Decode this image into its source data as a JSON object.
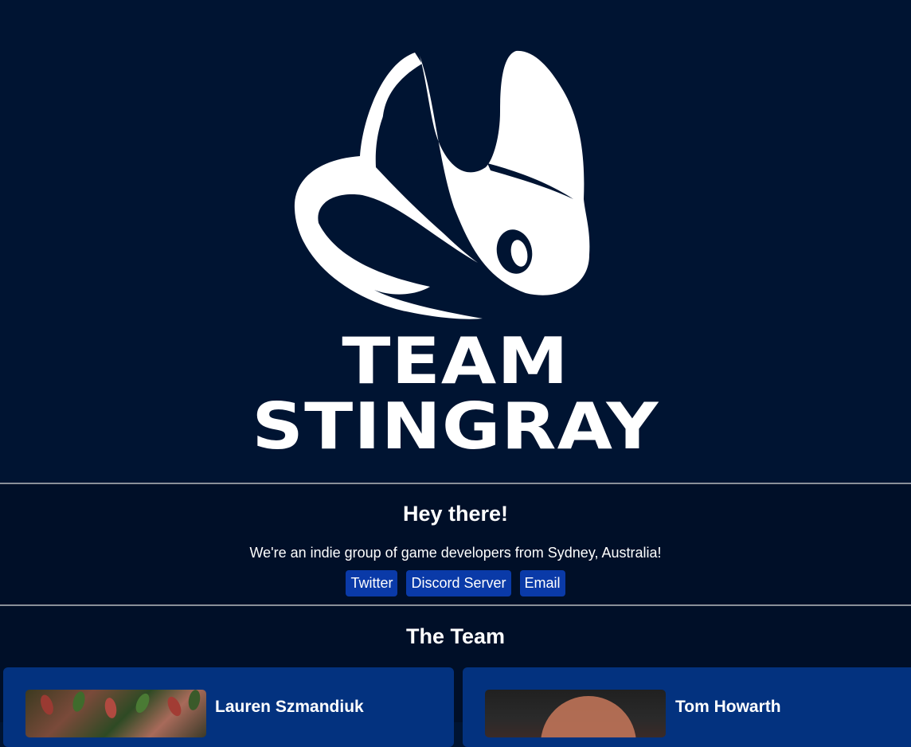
{
  "brand": {
    "logo_icon": "stingray-icon",
    "logo_line1": "TEAM",
    "logo_line2": "STINGRAY"
  },
  "intro": {
    "heading": "Hey there!",
    "description": "We're an indie group of game developers from Sydney, Australia!",
    "links": [
      {
        "label": "Twitter"
      },
      {
        "label": "Discord Server"
      },
      {
        "label": "Email"
      }
    ]
  },
  "team": {
    "heading": "The Team",
    "members": [
      {
        "name": "Lauren Szmandiuk"
      },
      {
        "name": "Tom Howarth"
      }
    ]
  },
  "colors": {
    "background": "#001432",
    "section_background": "#000f28",
    "button": "#0a3aa8",
    "card": "#03327f",
    "text": "#ffffff"
  }
}
